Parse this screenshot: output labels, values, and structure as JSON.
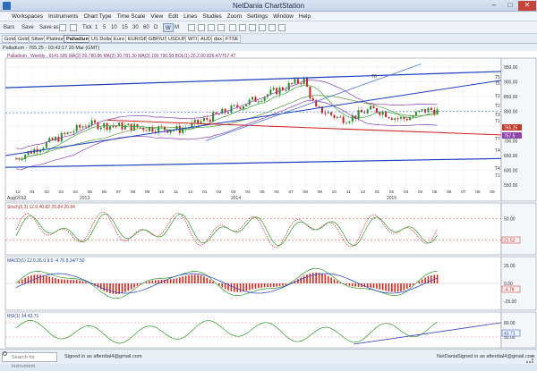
{
  "window": {
    "title": "NetDania ChartStation",
    "min_glyph": "–",
    "max_glyph": "□",
    "close_glyph": "✕"
  },
  "menu": [
    "Workspaces",
    "Instruments",
    "Chart Type",
    "Time Scale",
    "View",
    "Edit",
    "Lines",
    "Studies",
    "Zoom",
    "Settings",
    "Window",
    "Help"
  ],
  "toolbar": {
    "items": [
      "Bars",
      "Save",
      "Save as",
      "Tick",
      "1",
      "5",
      "10",
      "15",
      "30",
      "60",
      "D",
      "W",
      "M"
    ],
    "selected": "W"
  },
  "symbols": [
    "Gold",
    "Silver",
    "Platinum",
    "Palladium",
    "US Dollar",
    "Euro",
    "EUR/GBP",
    "GBP/USD",
    "USD/JPY",
    "WTI",
    "AUD",
    "dax",
    "FTSE"
  ],
  "active_symbol": "Palladium",
  "chart": {
    "window_title": "Palladium - 765.25 - 03:43:17  20 Mar (GMT)",
    "legend": "Palladium , Weekly , 6141.580  MA(2) 20.780.86  MA(2) 30.781.30  MA(3) 100.790.58  BOL(1) 20.2.00.826.47/757.47",
    "price_box": "765.25",
    "price_box_2": "757.5",
    "price_ticks": [
      "950.00",
      "900.00",
      "850.00",
      "800.00",
      "750.00",
      "700.00",
      "650.00",
      "600.00",
      "550.00"
    ],
    "month_labels": [
      "12",
      "01",
      "02",
      "03",
      "04",
      "05",
      "06",
      "07",
      "08",
      "09",
      "10",
      "11",
      "12",
      "01",
      "02",
      "03",
      "04",
      "05",
      "06",
      "07",
      "08",
      "09",
      "10",
      "11",
      "12",
      "01",
      "02",
      "03",
      "04",
      "05",
      "06",
      "07",
      "08",
      "09"
    ],
    "year_labels": [
      "Aug/2012",
      "2013",
      "2014",
      "2015"
    ],
    "line_labels": [
      "T5",
      "T2",
      "T3",
      "T1",
      "T2",
      "T5",
      "T4",
      "T7",
      "T8",
      "T1",
      "T4"
    ],
    "indicator_titles": {
      "stoch": "Stoch(6,3) 12.0.40.82  25.84 20.84",
      "macd": "MACD(1) 12.0.26.0.9.0 -4.76  8.34/7.50",
      "rsi": "RSI(1) 14  43.71"
    },
    "stoch_ticks": [
      "50.00",
      "20.00"
    ],
    "stoch_box": "21.52",
    "macd_ticks": [
      "25.00",
      "0.00",
      "-25.00"
    ],
    "macd_box": "-4.78",
    "rsi_ticks": [
      "80.00",
      "50.00"
    ],
    "rsi_box": "43.71"
  },
  "status": {
    "search_placeholder": "Search for instrument",
    "signin": "Signed in as afterdial4@gmail.com",
    "brand": "NetDania",
    "user": "Signed in as afterdial4@gmail.com"
  },
  "colors": {
    "accent": "#2c6db5",
    "up_candle": "#2a8a2a",
    "down_candle": "#cc1f1f",
    "trend_blue": "#1c3fbf",
    "trend_red": "#d42020",
    "ma_green": "#2fa83a",
    "ma_purple": "#8b3fb0"
  }
}
